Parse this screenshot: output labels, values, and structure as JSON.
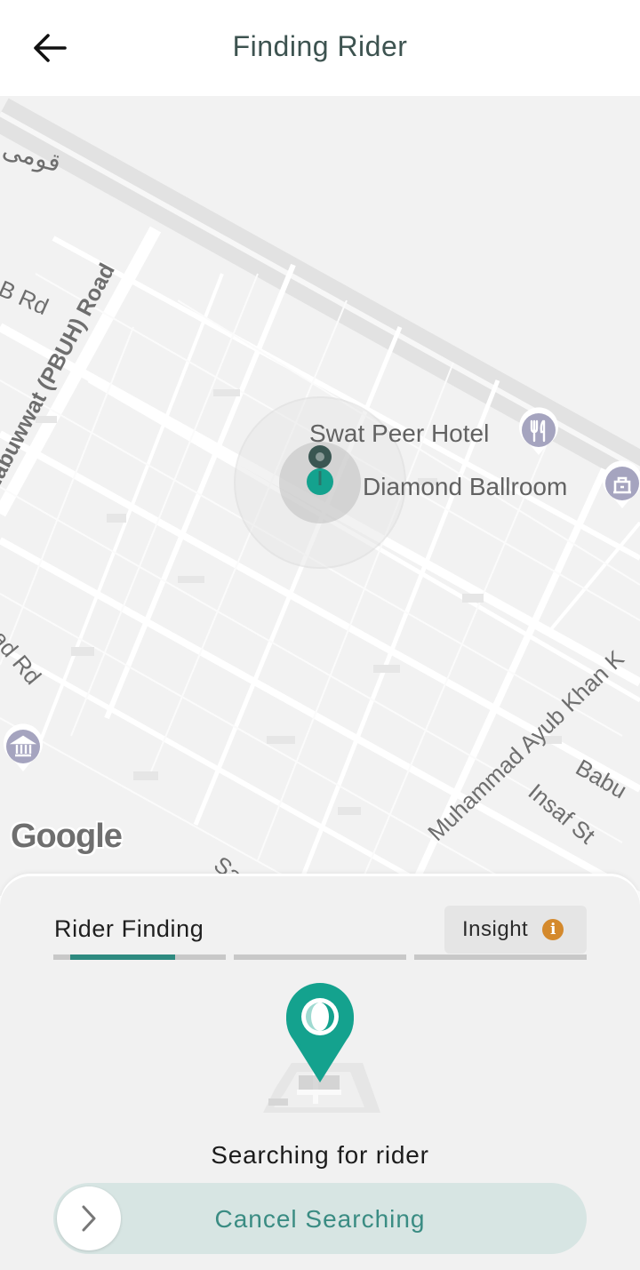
{
  "header": {
    "title": "Finding Rider",
    "back_icon": "arrow-left-icon"
  },
  "map": {
    "labels": {
      "urdu": "قومی",
      "b_rd": "B Rd",
      "nabuwwat": "Nabuwwat (PBUH) Road",
      "ad_rd": "ad Rd",
      "ayub": "Muhammad Ayub Khan K",
      "babu": "Babu",
      "insaf": "Insaf St",
      "sarh": "Sarh"
    },
    "pois": {
      "hotel": "Swat Peer Hotel",
      "ballroom": "Diamond Ballroom"
    },
    "attribution": "Google",
    "colors": {
      "pin": "#14a28e",
      "pin_dark": "#3a5652"
    }
  },
  "sheet": {
    "step_title": "Rider Finding",
    "insight_label": "Insight",
    "progress": {
      "steps": 3,
      "current_step": 1,
      "current_step_fill": 0.6
    },
    "status": "Searching for rider",
    "cancel_label": "Cancel Searching",
    "colors": {
      "accent": "#2e8a80",
      "slider_bg": "#d7e5e3",
      "info": "#d4892c"
    }
  }
}
